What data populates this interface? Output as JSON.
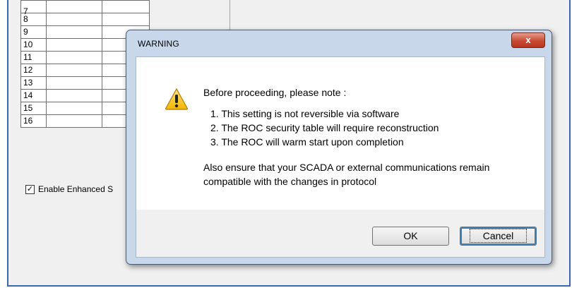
{
  "background": {
    "grid_rows": [
      "7",
      "8",
      "9",
      "10",
      "11",
      "12",
      "13",
      "14",
      "15",
      "16"
    ],
    "checkbox": {
      "label": "Enable Enhanced S",
      "checked": true
    }
  },
  "dialog": {
    "title": "WARNING",
    "close_label": "x",
    "icon": "warning-triangle-icon",
    "intro": "Before proceeding, please note :",
    "points": [
      "1. This setting is not reversible via software",
      "2. The ROC security table will require reconstruction",
      "3. The ROC will warm start upon completion"
    ],
    "outro": "Also ensure that your SCADA or external communications remain compatible with the changes in protocol",
    "ok_label": "OK",
    "cancel_label": "Cancel"
  }
}
